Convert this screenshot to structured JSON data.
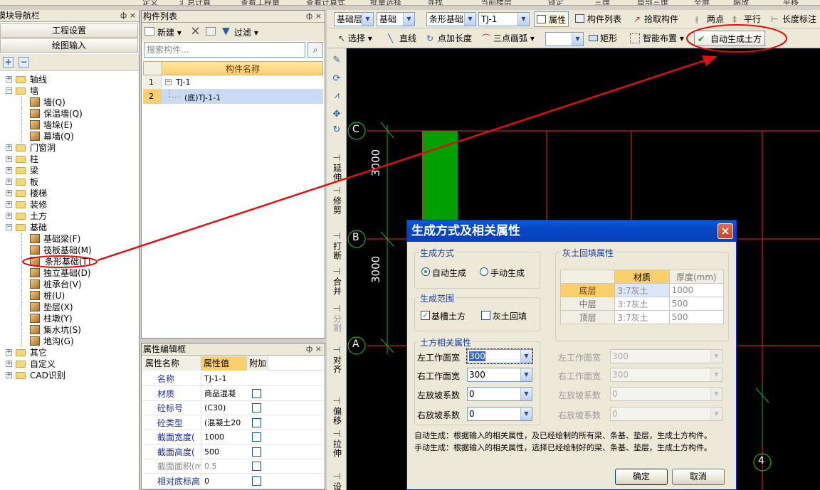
{
  "top_strip": [
    "定义",
    "汇总计算",
    "查看工程量",
    "查看计算式",
    "批量选择",
    "寻找",
    "当前楼层",
    "锁定",
    "三维",
    "局部三维",
    "全屏",
    "缩放",
    "平移"
  ],
  "nav": {
    "title": "模块导航栏",
    "pin": "ф ×",
    "btn_project": "工程设置",
    "btn_draw": "绘图输入",
    "plus": "+",
    "minus": "−",
    "tree": [
      {
        "label": "轴线",
        "expander": "+"
      },
      {
        "label": "墙",
        "expander": "−"
      },
      {
        "label": "墙(Q)",
        "child": true
      },
      {
        "label": "保温墙(Q)",
        "child": true
      },
      {
        "label": "墙垛(E)",
        "child": true
      },
      {
        "label": "幕墙(Q)",
        "child": true
      },
      {
        "label": "门窗洞",
        "expander": "+"
      },
      {
        "label": "柱",
        "expander": "+"
      },
      {
        "label": "梁",
        "expander": "+"
      },
      {
        "label": "板",
        "expander": "+"
      },
      {
        "label": "楼梯",
        "expander": "+"
      },
      {
        "label": "装修",
        "expander": "+"
      },
      {
        "label": "土方",
        "expander": "+"
      },
      {
        "label": "基础",
        "expander": "−"
      },
      {
        "label": "基础梁(F)",
        "child": true
      },
      {
        "label": "筏板基础(M)",
        "child": true
      },
      {
        "label": "条形基础(T)",
        "child": true,
        "selected": true
      },
      {
        "label": "独立基础(D)",
        "child": true
      },
      {
        "label": "桩承台(V)",
        "child": true
      },
      {
        "label": "桩(U)",
        "child": true
      },
      {
        "label": "垫层(X)",
        "child": true
      },
      {
        "label": "柱墩(Y)",
        "child": true
      },
      {
        "label": "集水坑(S)",
        "child": true
      },
      {
        "label": "地沟(G)",
        "child": true
      },
      {
        "label": "其它",
        "expander": "+"
      },
      {
        "label": "自定义",
        "expander": "+"
      },
      {
        "label": "CAD识别",
        "expander": "+"
      }
    ]
  },
  "component_list": {
    "title": "构件列表",
    "pin": "ф ×",
    "new_label": "新建",
    "delete_icon": "×",
    "filter_label": "过滤",
    "search_placeholder": "搜索构件...",
    "column_header": "构件名称",
    "rows": [
      {
        "num": "1",
        "name": "TJ-1",
        "expander": "−"
      },
      {
        "num": "2",
        "name": "(底)TJ-1-1"
      }
    ]
  },
  "props": {
    "title": "属性编辑框",
    "pin": "ф ×",
    "headers": [
      "属性名称",
      "属性值",
      "附加"
    ],
    "rows": [
      {
        "name": "名称",
        "value": "TJ-1-1",
        "checkbox": false
      },
      {
        "name": "材质",
        "value": "商品混凝",
        "checkbox": true
      },
      {
        "name": "砼标号",
        "value": "(C30)",
        "checkbox": true
      },
      {
        "name": "砼类型",
        "value": "(混凝土20",
        "checkbox": true
      },
      {
        "name": "截面宽度(",
        "value": "1000",
        "checkbox": true
      },
      {
        "name": "截面高度(",
        "value": "500",
        "checkbox": true
      },
      {
        "name": "截面面积(m",
        "value": "0.5",
        "checkbox": true,
        "muted": true
      },
      {
        "name": "相对底标高",
        "value": "0",
        "checkbox": true
      }
    ]
  },
  "toolbar1": {
    "floor": "基础层",
    "category": "基础",
    "type": "条形基础",
    "component": "TJ-1",
    "btn_property": "属性",
    "btn_component_list": "构件列表",
    "btn_pick": "拾取构件",
    "btn_two_point": "两点",
    "btn_parallel": "平行",
    "btn_length_dim": "长度标注"
  },
  "toolbar2": {
    "select": "选择",
    "line": "直线",
    "point_length": "点加长度",
    "three_point_arc": "三点画弧",
    "rect": "矩形",
    "smart_layout": "智能布置",
    "auto_earthwork": "自动生成土方"
  },
  "vertical_tools": [
    "延伸",
    "修剪",
    "打断",
    "合并",
    "分割",
    "对齐",
    "偏移",
    "拉伸",
    "设"
  ],
  "canvas": {
    "axis_labels": [
      "C",
      "B",
      "A",
      "4"
    ],
    "dims": [
      "3000",
      "3000"
    ],
    "accent": "#00a000",
    "grid_color": "#ff2020"
  },
  "dialog": {
    "title": "生成方式及相关属性",
    "close": "×",
    "gen_method_title": "生成方式",
    "auto_label": "自动生成",
    "manual_label": "手动生成",
    "range_title": "生成范围",
    "range_groove": "基槽土方",
    "range_fill": "灰土回填",
    "earth_title": "土方相关属性",
    "fill_title": "灰土回填属性",
    "fields": [
      {
        "label": "左工作面宽",
        "value": "300"
      },
      {
        "label": "右工作面宽",
        "value": "300"
      },
      {
        "label": "左放坡系数",
        "value": "0"
      },
      {
        "label": "右放坡系数",
        "value": "0"
      }
    ],
    "fill_fields": [
      {
        "label": "左工作面宽",
        "value": "300"
      },
      {
        "label": "右工作面宽",
        "value": "300"
      },
      {
        "label": "左放坡系数",
        "value": "0"
      },
      {
        "label": "右放坡系数",
        "value": "0"
      }
    ],
    "fill_table": {
      "headers": [
        "",
        "材质",
        "厚度(mm)"
      ],
      "rows": [
        [
          "底层",
          "3:7灰土",
          "1000"
        ],
        [
          "中层",
          "3:7灰土",
          "500"
        ],
        [
          "顶层",
          "3:7灰土",
          "500"
        ]
      ]
    },
    "note_auto": "自动生成：根据输入的相关属性，及已经绘制的所有梁、条基、垫层，生成土方构件。",
    "note_manual": "手动生成：根据输入的相关属性，选择已经绘制好的梁、条基、垫层，生成土方构件。",
    "ok": "确定",
    "cancel": "取消"
  },
  "annotation_color": "#e01010"
}
